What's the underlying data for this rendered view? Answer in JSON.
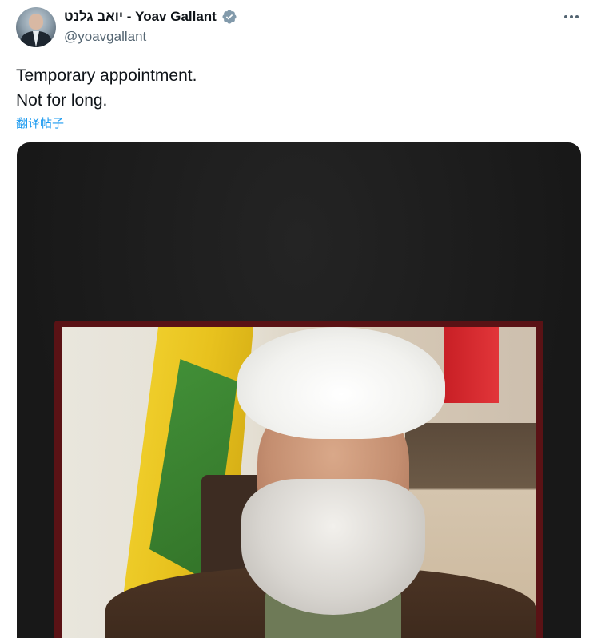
{
  "tweet": {
    "display_name": "יואב גלנט - Yoav Gallant",
    "handle": "@yoavgallant",
    "verified": true,
    "text_lines": [
      "Temporary appointment.",
      "Not for long."
    ],
    "translate_label": "翻译帖子"
  },
  "icons": {
    "verified": "verified-badge-icon",
    "more": "more-options-icon"
  },
  "colors": {
    "accent": "#1d9bf0",
    "secondary_text": "#536471",
    "verified_badge": "#829aab",
    "media_background": "#1b1b1b",
    "photo_frame": "#5a1215"
  }
}
